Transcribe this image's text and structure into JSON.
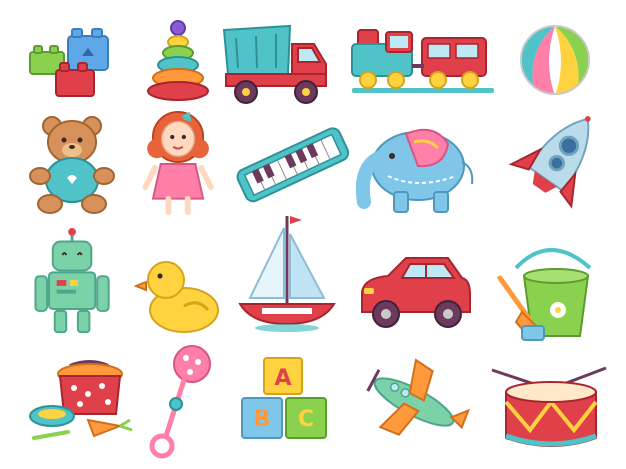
{
  "image": {
    "background": "#ffffff",
    "items": [
      {
        "icon": "building-blocks-icon",
        "row": 1,
        "col": 1
      },
      {
        "icon": "stacking-pyramid-icon",
        "row": 1,
        "col": 2
      },
      {
        "icon": "dump-truck-icon",
        "row": 1,
        "col": 3
      },
      {
        "icon": "toy-train-icon",
        "row": 1,
        "col": 4
      },
      {
        "icon": "beach-ball-icon",
        "row": 1,
        "col": 5
      },
      {
        "icon": "teddy-bear-icon",
        "row": 2,
        "col": 1
      },
      {
        "icon": "doll-icon",
        "row": 2,
        "col": 2
      },
      {
        "icon": "toy-piano-icon",
        "row": 2,
        "col": 3
      },
      {
        "icon": "toy-elephant-icon",
        "row": 2,
        "col": 4
      },
      {
        "icon": "toy-rocket-icon",
        "row": 2,
        "col": 5
      },
      {
        "icon": "toy-robot-icon",
        "row": 3,
        "col": 1
      },
      {
        "icon": "rubber-duck-icon",
        "row": 3,
        "col": 2
      },
      {
        "icon": "toy-sailboat-icon",
        "row": 3,
        "col": 3
      },
      {
        "icon": "toy-car-icon",
        "row": 3,
        "col": 4
      },
      {
        "icon": "sand-bucket-icon",
        "row": 3,
        "col": 5
      },
      {
        "icon": "toy-kitchen-pot-icon",
        "row": 4,
        "col": 1
      },
      {
        "icon": "baby-rattle-icon",
        "row": 4,
        "col": 2
      },
      {
        "icon": "abc-blocks-icon",
        "row": 4,
        "col": 3
      },
      {
        "icon": "toy-airplane-icon",
        "row": 4,
        "col": 4
      },
      {
        "icon": "toy-drum-icon",
        "row": 4,
        "col": 5
      }
    ],
    "block_letters": {
      "a": "A",
      "b": "B",
      "c": "C"
    },
    "colors": {
      "teal": "#4fc3c7",
      "red": "#e0404a",
      "yellow": "#ffd23f",
      "pink": "#ff7fa8",
      "green": "#8ad14f",
      "blue": "#5fa8e8",
      "orange": "#ff9a3c"
    }
  }
}
